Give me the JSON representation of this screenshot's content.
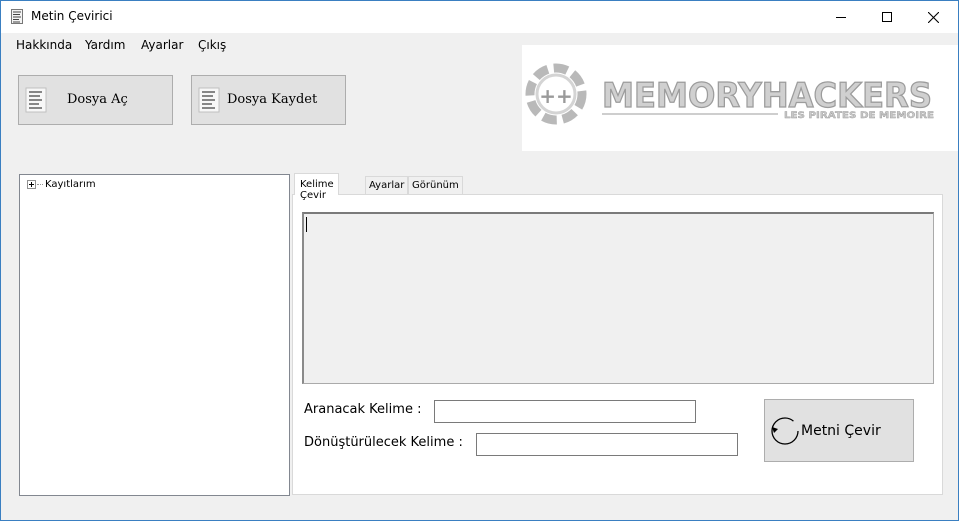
{
  "window": {
    "title": "Metin Çevirici",
    "controls": [
      "minimize",
      "maximize",
      "close"
    ]
  },
  "menu": [
    "Hakkında",
    "Yardım",
    "Ayarlar",
    "Çıkış"
  ],
  "toolbar": {
    "open_label": "Dosya Aç",
    "save_label": "Dosya Kaydet"
  },
  "logo": {
    "text": "MEMORYHACKERS",
    "subtitle": "LES PIRATES DE MEMOIRE",
    "badge": "++"
  },
  "tree": {
    "root_label": "Kayıtlarım"
  },
  "tabs": [
    "Kelime Çevir",
    "Ayarlar",
    "Görünüm"
  ],
  "form": {
    "search_label": "Aranacak Kelime :",
    "search_value": "",
    "replace_label": "Dönüştürülecek Kelime :",
    "replace_value": "",
    "convert_label": "Metni Çevir"
  }
}
